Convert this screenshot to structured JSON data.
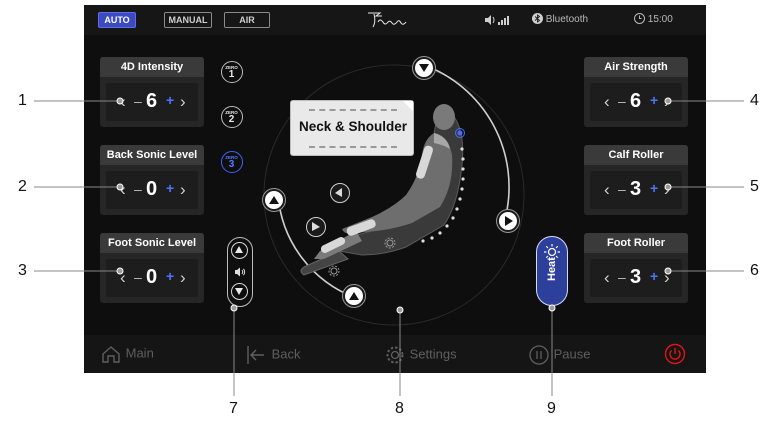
{
  "topbar": {
    "modes": [
      "AUTO",
      "MANUAL",
      "AIR"
    ],
    "active_mode": "AUTO",
    "bluetooth_label": "Bluetooth",
    "time": "15:00"
  },
  "left_panels": [
    {
      "title": "4D Intensity",
      "value": "6"
    },
    {
      "title": "Back Sonic Level",
      "value": "0"
    },
    {
      "title": "Foot Sonic Level",
      "value": "0"
    }
  ],
  "right_panels": [
    {
      "title": "Air Strength",
      "value": "6"
    },
    {
      "title": "Calf Roller",
      "value": "3"
    },
    {
      "title": "Foot Roller",
      "value": "3"
    }
  ],
  "stepper_symbols": {
    "decrease": "‹",
    "minus": "–",
    "plus": "+",
    "increase": "›"
  },
  "zero_buttons": [
    {
      "label": "ZERO",
      "number": "1"
    },
    {
      "label": "ZERO",
      "number": "2"
    },
    {
      "label": "ZERO",
      "number": "3"
    }
  ],
  "active_zero": "3",
  "chair": {
    "focus_label": "Neck & Shoulder"
  },
  "heat": {
    "label": "Heat"
  },
  "nav": {
    "main": "Main",
    "back": "Back",
    "settings": "Settings",
    "pause": "Pause"
  },
  "callouts": [
    "1",
    "2",
    "3",
    "4",
    "5",
    "6",
    "7",
    "8",
    "9"
  ],
  "colors": {
    "accent": "#3b4bbf",
    "plus_blue": "#4e74ff",
    "power_red": "#e01515",
    "screen_bg": "#0e0e0e"
  },
  "icons": {
    "home": "home-icon",
    "back": "back-arrow-icon",
    "settings": "gear-icon",
    "pause": "pause-icon",
    "power": "power-icon",
    "speaker": "speaker-icon",
    "sun": "sun-icon",
    "bluetooth": "bluetooth-icon",
    "clock": "clock-icon"
  }
}
